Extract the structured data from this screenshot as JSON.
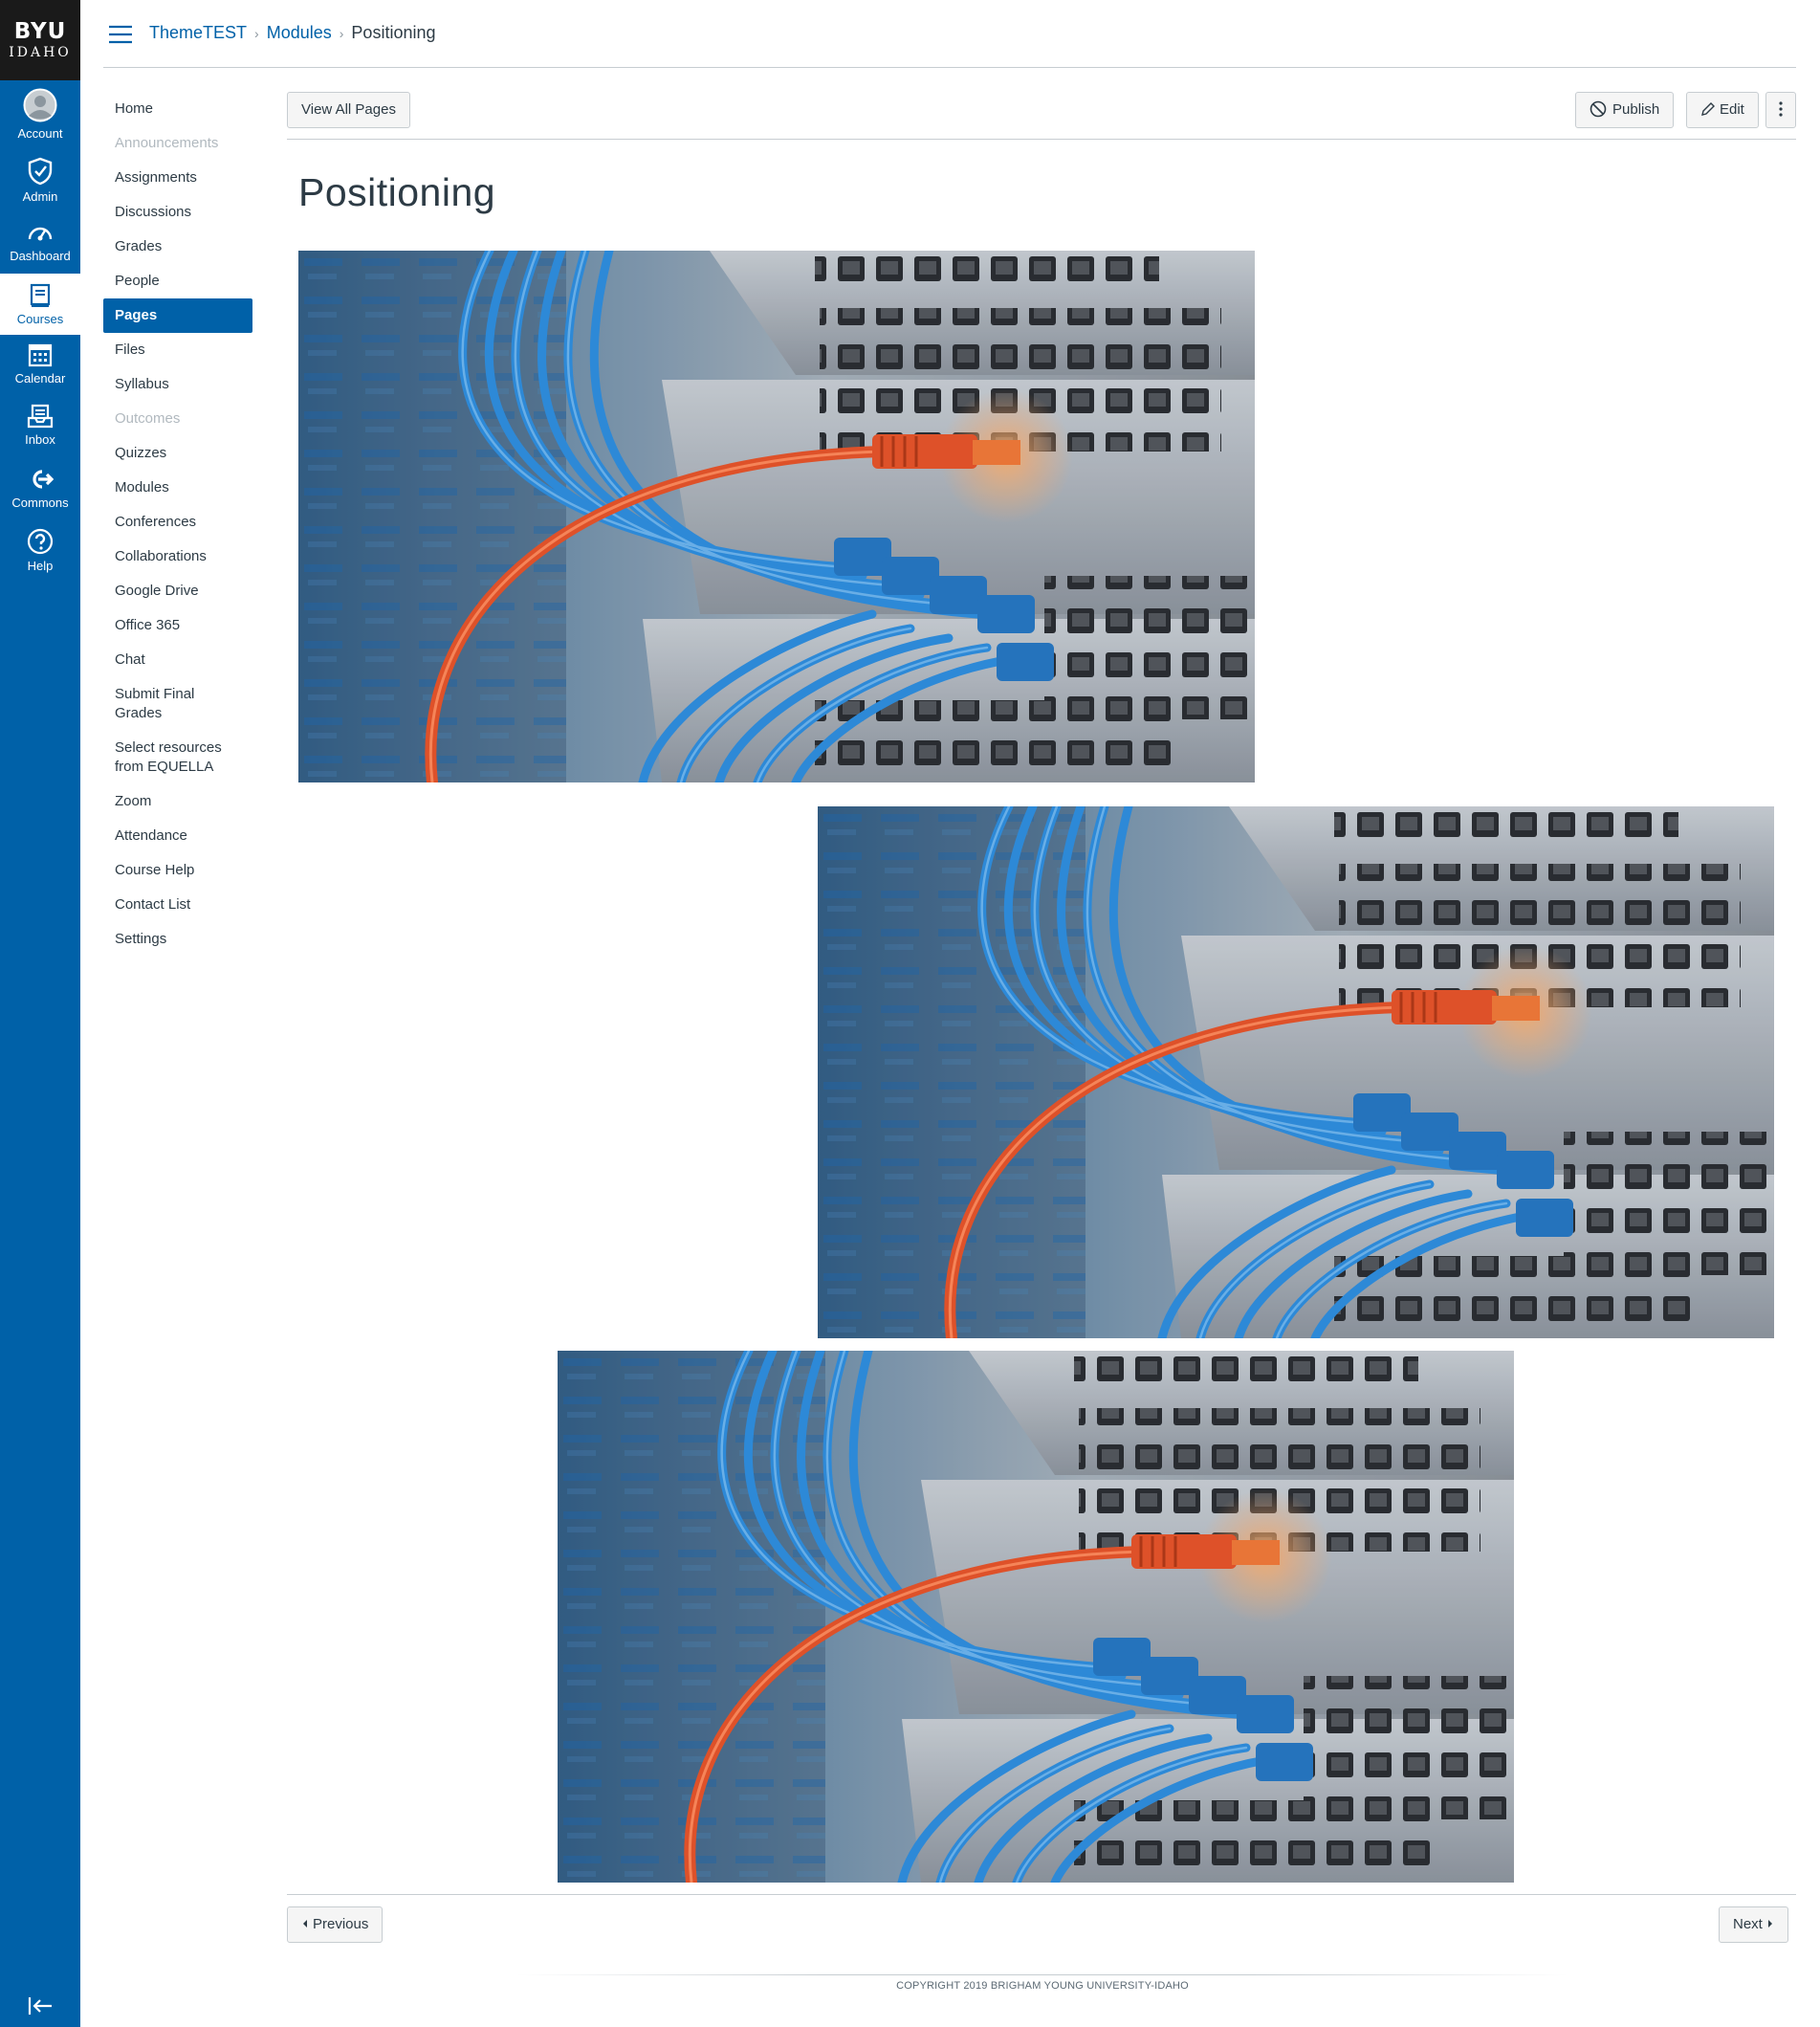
{
  "global_nav": {
    "logo": {
      "line1": "BYU",
      "line2": "IDAHO"
    },
    "items": [
      {
        "label": "Account",
        "icon": "avatar-icon"
      },
      {
        "label": "Admin",
        "icon": "shield-icon"
      },
      {
        "label": "Dashboard",
        "icon": "speedometer-icon"
      },
      {
        "label": "Courses",
        "icon": "book-icon"
      },
      {
        "label": "Calendar",
        "icon": "calendar-icon"
      },
      {
        "label": "Inbox",
        "icon": "inbox-icon"
      },
      {
        "label": "Commons",
        "icon": "commons-icon"
      },
      {
        "label": "Help",
        "icon": "question-icon"
      }
    ],
    "active": "Courses",
    "collapse_icon": "collapse-arrow-icon"
  },
  "breadcrumb": {
    "items": [
      "ThemeTEST",
      "Modules",
      "Positioning"
    ]
  },
  "course_nav": {
    "items": [
      {
        "label": "Home"
      },
      {
        "label": "Announcements",
        "disabled": true
      },
      {
        "label": "Assignments"
      },
      {
        "label": "Discussions"
      },
      {
        "label": "Grades"
      },
      {
        "label": "People"
      },
      {
        "label": "Pages",
        "active": true
      },
      {
        "label": "Files"
      },
      {
        "label": "Syllabus"
      },
      {
        "label": "Outcomes",
        "disabled": true
      },
      {
        "label": "Quizzes"
      },
      {
        "label": "Modules"
      },
      {
        "label": "Conferences"
      },
      {
        "label": "Collaborations"
      },
      {
        "label": "Google Drive"
      },
      {
        "label": "Office 365"
      },
      {
        "label": "Chat"
      },
      {
        "label": "Submit Final Grades"
      },
      {
        "label": "Select resources from EQUELLA"
      },
      {
        "label": "Zoom"
      },
      {
        "label": "Attendance"
      },
      {
        "label": "Course Help"
      },
      {
        "label": "Contact List"
      },
      {
        "label": "Settings"
      }
    ]
  },
  "toolbar": {
    "view_all": "View All Pages",
    "publish": "Publish",
    "edit": "Edit"
  },
  "page": {
    "title": "Positioning",
    "images": [
      {
        "alt": "network-cables-photo",
        "alignment": "left"
      },
      {
        "alt": "network-cables-photo",
        "alignment": "right"
      },
      {
        "alt": "network-cables-photo",
        "alignment": "center"
      }
    ]
  },
  "pager": {
    "previous": "Previous",
    "next": "Next"
  },
  "footer": {
    "copyright": "COPYRIGHT 2019 BRIGHAM YOUNG UNIVERSITY-IDAHO"
  },
  "colors": {
    "brand": "#0061a8",
    "logo_bg": "#1a1a1a",
    "cable_orange": "#e8552b",
    "cable_blue": "#2f8fe0"
  }
}
